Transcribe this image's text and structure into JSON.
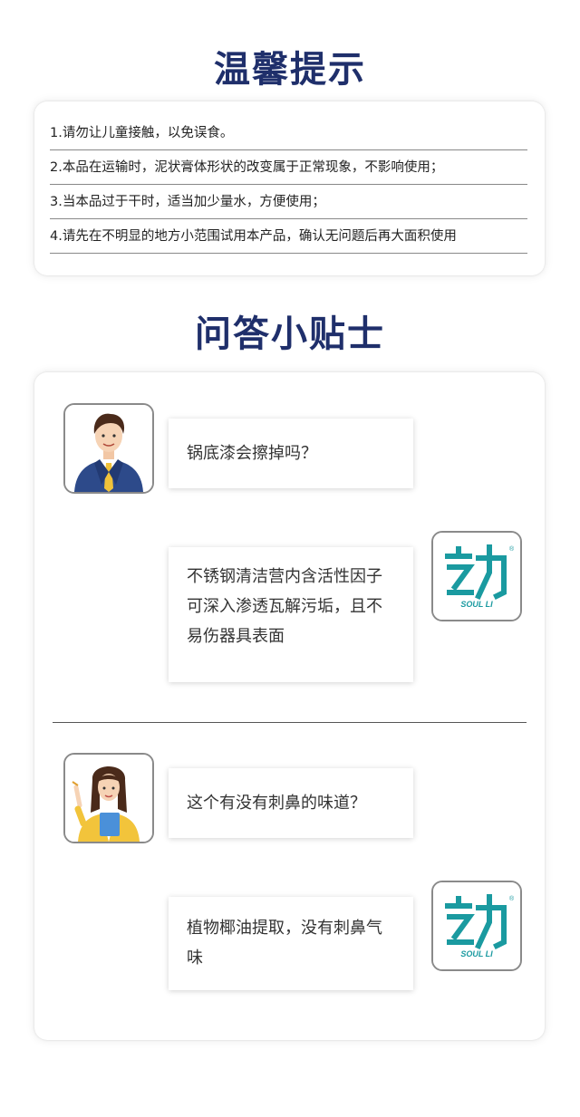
{
  "tips_section": {
    "title": "温馨提示",
    "items": [
      "1.请勿让儿童接触，以免误食。",
      "2.本品在运输时，泥状膏体形状的改变属于正常现象，不影响使用；",
      "3.当本品过于干时，适当加少量水，方便使用；",
      "4.请先在不明显的地方小范围试用本产品，确认无问题后再大面积使用"
    ]
  },
  "qa_section": {
    "title": "问答小贴士",
    "qa": [
      {
        "asker_icon": "man-avatar-icon",
        "question": "锅底漆会擦掉吗？",
        "answer": "不锈钢清洁营内含活性因子可深入渗透瓦解污垢，且不易伤器具表面"
      },
      {
        "asker_icon": "woman-avatar-icon",
        "question": "这个有没有刺鼻的味道？",
        "answer": "植物椰油提取，没有刺鼻气味"
      }
    ],
    "brand_logo": {
      "icon": "brand-logo-icon",
      "text": "SOUL LI",
      "mark": "®",
      "color": "#1a9aa0"
    }
  }
}
